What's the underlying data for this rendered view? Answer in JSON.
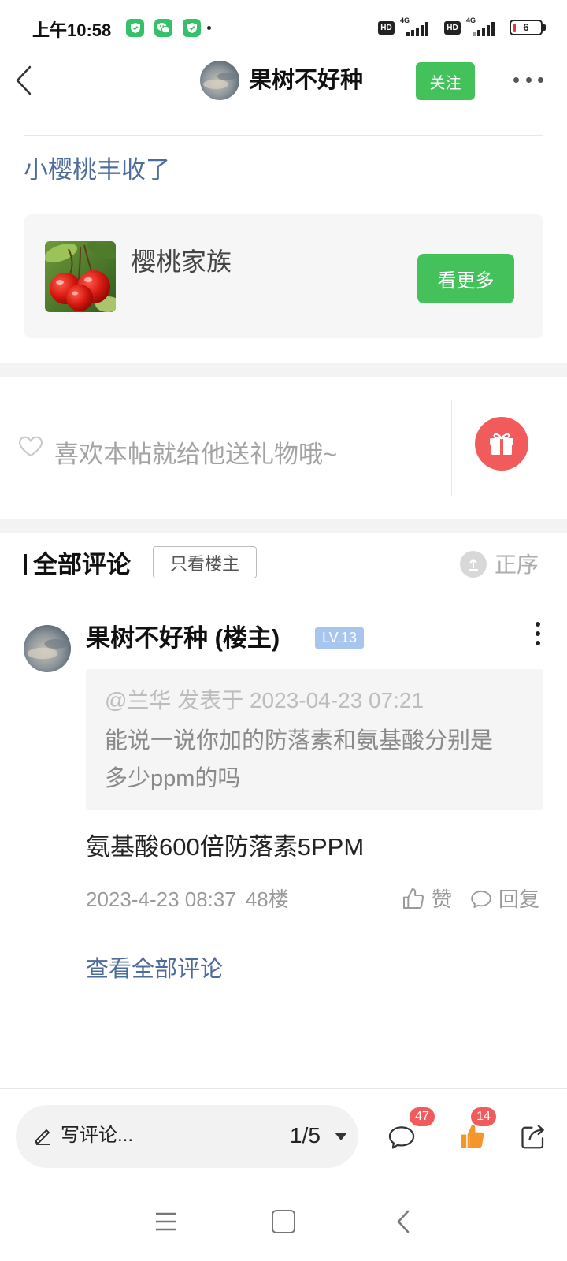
{
  "status_bar": {
    "time": "上午10:58",
    "app_icons": [
      "shield-app-icon",
      "wechat-icon",
      "shield-app-icon"
    ],
    "hd_label_1": "HD",
    "network_1": "4G",
    "hd_label_2": "HD",
    "network_2": "4G",
    "battery": "6"
  },
  "header": {
    "title": "果树不好种",
    "follow_label": "关注"
  },
  "post": {
    "title": "小樱桃丰收了"
  },
  "group_card": {
    "name": "樱桃家族",
    "more_label": "看更多"
  },
  "gift": {
    "prompt": "喜欢本帖就给他送礼物哦~"
  },
  "comments": {
    "title": "全部评论",
    "owner_only_label": "只看楼主",
    "sort_label": "正序",
    "items": [
      {
        "author": "果树不好种 (楼主)",
        "level": "LV.13",
        "quote": {
          "meta": "@兰华 发表于 2023-04-23 07:21",
          "lines": [
            "能说一说你加的防落素和氨基酸分别是",
            "多少ppm的吗"
          ]
        },
        "text": "氨基酸600倍防落素5PPM",
        "time": "2023-4-23 08:37",
        "floor": "48楼",
        "like_label": "赞",
        "reply_label": "回复"
      }
    ],
    "view_all_label": "查看全部评论"
  },
  "bottom_bar": {
    "comment_placeholder": "写评论...",
    "page_indicator": "1/5",
    "comment_count": "47",
    "like_count": "14"
  },
  "colors": {
    "accent_green": "#43c15b",
    "link_blue": "#4e6c9b",
    "badge_red": "#f25b5b",
    "like_orange": "#f5962a",
    "level_badge": "#a8c5ee"
  }
}
